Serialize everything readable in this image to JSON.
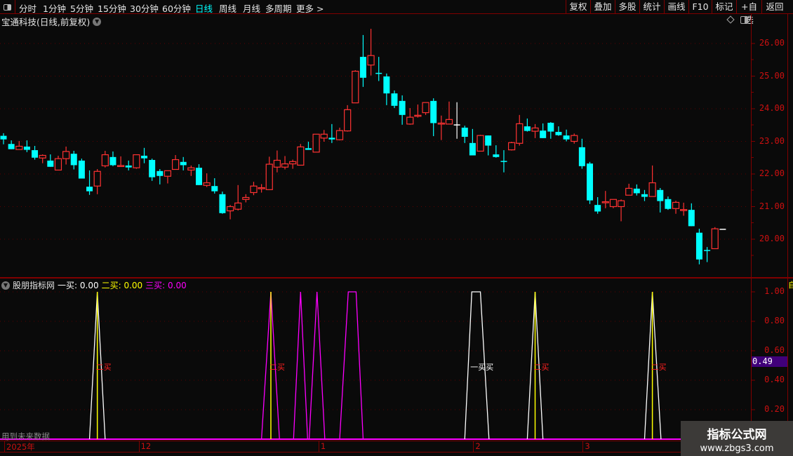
{
  "toolbar": {
    "periods": [
      "分时",
      "1分钟",
      "5分钟",
      "15分钟",
      "30分钟",
      "60分钟",
      "日线",
      "周线",
      "月线",
      "多周期",
      "更多 >"
    ],
    "active_period": "日线",
    "buttons": [
      "复权",
      "叠加",
      "多股",
      "统计",
      "画线",
      "F10",
      "标记",
      "+自选",
      "返回"
    ]
  },
  "stock_title": "宝通科技(日线,前复权)",
  "colors": {
    "up": "#ff3232",
    "down": "#00ffff",
    "doji": "#ffffff",
    "axis": "#800000",
    "label": "#cc1010",
    "magenta": "#ff00ff",
    "yellow": "#ffff00"
  },
  "price_axis": {
    "ticks": [
      "26.00",
      "25.00",
      "24.00",
      "23.00",
      "22.00",
      "21.00",
      "20.00"
    ]
  },
  "chart_data": {
    "type": "candlestick",
    "ylim": [
      19.0,
      26.5
    ],
    "ohlc": [
      [
        23.17,
        23.25,
        22.91,
        23.06
      ],
      [
        22.92,
        23.03,
        22.76,
        22.76
      ],
      [
        22.75,
        23.01,
        22.75,
        22.85
      ],
      [
        22.84,
        23.03,
        22.67,
        22.74
      ],
      [
        22.73,
        22.86,
        22.44,
        22.5
      ],
      [
        22.49,
        22.6,
        22.33,
        22.57
      ],
      [
        22.41,
        22.6,
        22.22,
        22.22
      ],
      [
        22.12,
        22.56,
        22.12,
        22.47
      ],
      [
        22.47,
        22.84,
        22.29,
        22.69
      ],
      [
        22.62,
        22.71,
        22.14,
        22.27
      ],
      [
        22.41,
        22.47,
        21.86,
        21.86
      ],
      [
        21.61,
        22.11,
        21.36,
        21.47
      ],
      [
        21.63,
        22.15,
        21.38,
        22.08
      ],
      [
        22.25,
        22.71,
        22.2,
        22.59
      ],
      [
        22.52,
        22.69,
        22.24,
        22.27
      ],
      [
        22.24,
        22.54,
        22.22,
        22.26
      ],
      [
        22.26,
        22.41,
        22.11,
        22.2
      ],
      [
        22.19,
        22.59,
        22.16,
        22.59
      ],
      [
        22.56,
        22.8,
        22.33,
        22.48
      ],
      [
        22.43,
        22.47,
        21.79,
        21.9
      ],
      [
        22.09,
        22.15,
        21.68,
        21.94
      ],
      [
        21.93,
        22.1,
        21.71,
        22.1
      ],
      [
        22.14,
        22.58,
        22.14,
        22.44
      ],
      [
        22.37,
        22.52,
        22.11,
        22.27
      ],
      [
        22.12,
        22.26,
        21.94,
        22.19
      ],
      [
        22.19,
        22.3,
        21.66,
        21.66
      ],
      [
        21.65,
        22.02,
        21.6,
        21.73
      ],
      [
        21.63,
        21.87,
        21.4,
        21.47
      ],
      [
        21.38,
        21.46,
        20.78,
        20.8
      ],
      [
        20.87,
        21.05,
        20.61,
        21.0
      ],
      [
        20.92,
        21.66,
        20.88,
        21.11
      ],
      [
        21.22,
        21.38,
        21.13,
        21.28
      ],
      [
        21.43,
        21.76,
        21.35,
        21.63
      ],
      [
        21.57,
        21.69,
        21.43,
        21.58
      ],
      [
        21.52,
        22.53,
        21.52,
        22.3
      ],
      [
        22.21,
        22.72,
        22.05,
        22.42
      ],
      [
        22.21,
        22.55,
        22.14,
        22.31
      ],
      [
        22.31,
        22.44,
        22.16,
        22.38
      ],
      [
        22.27,
        22.92,
        22.27,
        22.83
      ],
      [
        22.79,
        22.99,
        22.74,
        22.74
      ],
      [
        22.67,
        23.22,
        22.67,
        23.22
      ],
      [
        23.1,
        23.35,
        22.99,
        23.22
      ],
      [
        23.11,
        23.53,
        22.95,
        23.06
      ],
      [
        23.05,
        23.42,
        23.03,
        23.33
      ],
      [
        23.32,
        24.11,
        23.3,
        23.97
      ],
      [
        24.18,
        25.18,
        24.18,
        25.15
      ],
      [
        25.59,
        26.26,
        24.67,
        24.95
      ],
      [
        25.34,
        26.45,
        25.02,
        25.63
      ],
      [
        25.1,
        25.59,
        24.85,
        25.08
      ],
      [
        24.99,
        25.08,
        24.11,
        24.47
      ],
      [
        24.47,
        24.56,
        24.02,
        24.09
      ],
      [
        24.24,
        24.41,
        23.51,
        23.81
      ],
      [
        23.53,
        24.02,
        23.51,
        23.74
      ],
      [
        23.78,
        24.13,
        23.73,
        23.8
      ],
      [
        23.88,
        24.19,
        23.81,
        24.19
      ],
      [
        24.24,
        24.32,
        23.16,
        23.56
      ],
      [
        23.55,
        23.79,
        23.04,
        23.56
      ],
      [
        23.53,
        24.22,
        23.53,
        23.67
      ],
      [
        23.52,
        24.2,
        23.08,
        23.52
      ],
      [
        23.42,
        23.48,
        22.95,
        23.14
      ],
      [
        22.95,
        23.38,
        22.57,
        22.57
      ],
      [
        22.7,
        23.2,
        22.7,
        23.18
      ],
      [
        23.18,
        23.18,
        22.57,
        22.87
      ],
      [
        22.6,
        22.88,
        22.5,
        22.52
      ],
      [
        22.4,
        22.73,
        22.05,
        22.39
      ],
      [
        22.74,
        22.99,
        22.72,
        22.96
      ],
      [
        22.94,
        23.81,
        22.87,
        23.54
      ],
      [
        23.46,
        23.7,
        23.3,
        23.32
      ],
      [
        23.31,
        23.53,
        23.1,
        23.41
      ],
      [
        23.33,
        23.55,
        23.1,
        23.1
      ],
      [
        23.57,
        23.59,
        23.08,
        23.3
      ],
      [
        23.29,
        23.46,
        23.17,
        23.19
      ],
      [
        23.18,
        23.36,
        23.0,
        23.06
      ],
      [
        23.0,
        23.24,
        22.93,
        23.18
      ],
      [
        22.82,
        23.08,
        22.16,
        22.24
      ],
      [
        22.32,
        22.37,
        21.08,
        21.19
      ],
      [
        21.05,
        21.29,
        20.78,
        20.85
      ],
      [
        21.14,
        21.48,
        20.95,
        21.15
      ],
      [
        21.0,
        21.22,
        20.95,
        21.22
      ],
      [
        21.0,
        21.22,
        20.55,
        21.18
      ],
      [
        21.35,
        21.7,
        21.35,
        21.56
      ],
      [
        21.55,
        21.68,
        21.34,
        21.41
      ],
      [
        21.38,
        21.51,
        21.17,
        21.3
      ],
      [
        21.31,
        22.26,
        21.31,
        21.73
      ],
      [
        21.51,
        21.57,
        20.82,
        21.17
      ],
      [
        21.23,
        21.31,
        20.9,
        20.93
      ],
      [
        20.94,
        21.18,
        20.78,
        21.13
      ],
      [
        20.9,
        21.12,
        20.72,
        20.91
      ],
      [
        20.9,
        21.1,
        20.4,
        20.4
      ],
      [
        20.2,
        20.32,
        19.23,
        19.38
      ],
      [
        19.67,
        19.76,
        19.3,
        19.65
      ],
      [
        19.71,
        20.37,
        19.71,
        20.32
      ],
      [
        20.32,
        20.32,
        20.32,
        20.32
      ]
    ]
  },
  "indicator": {
    "name": "股朋指标网",
    "legend": [
      {
        "label": "一买: 0.00",
        "color": "#ffffff"
      },
      {
        "label": "二买: 0.00",
        "color": "#ffff00"
      },
      {
        "label": "三买: 0.00",
        "color": "#ff00ff"
      }
    ],
    "ticks": [
      "1.00",
      "0.80",
      "0.60",
      "0.40",
      "0.20"
    ],
    "current_value": "0.49",
    "ylim": [
      0,
      1.05
    ],
    "signals": [
      {
        "start": 11,
        "peak_from": 12,
        "peak_to": 12,
        "end": 13,
        "color": "#ffffff",
        "stick": true,
        "label": "二买"
      },
      {
        "start": 33,
        "peak_from": 34.2,
        "peak_to": 34.2,
        "end": 35.3,
        "color": "#ff00ff",
        "stick": true,
        "label": "二买"
      },
      {
        "start": 37.1,
        "peak_from": 38,
        "peak_to": 38,
        "end": 38.9,
        "color": "#ff00ff",
        "stick": false,
        "label": ""
      },
      {
        "start": 39.1,
        "peak_from": 40.1,
        "peak_to": 40.1,
        "end": 41.1,
        "color": "#ff00ff",
        "stick": false,
        "label": ""
      },
      {
        "start": 43,
        "peak_from": 44.1,
        "peak_to": 45.1,
        "end": 46,
        "color": "#ff00ff",
        "stick": false,
        "label": ""
      },
      {
        "start": 59,
        "peak_from": 59.9,
        "peak_to": 61,
        "end": 62.1,
        "color": "#ffffff",
        "stick": false,
        "label": "一买买"
      },
      {
        "start": 67,
        "peak_from": 68,
        "peak_to": 68,
        "end": 69,
        "color": "#ffffff",
        "stick": true,
        "label": "二买"
      },
      {
        "start": 82,
        "peak_from": 83,
        "peak_to": 83,
        "end": 84.1,
        "color": "#ffffff",
        "stick": true,
        "label": "二买"
      }
    ],
    "future_warning": "用到未来数据"
  },
  "time_axis": [
    {
      "label": "2025年",
      "index": 0
    },
    {
      "label": "12",
      "index": 17.2
    },
    {
      "label": "1",
      "index": 40.2
    },
    {
      "label": "2",
      "index": 60
    },
    {
      "label": "3",
      "index": 74
    }
  ],
  "side_tab": "自",
  "watermark": {
    "title": "指标公式网",
    "url": "www.zbgs3.com"
  }
}
